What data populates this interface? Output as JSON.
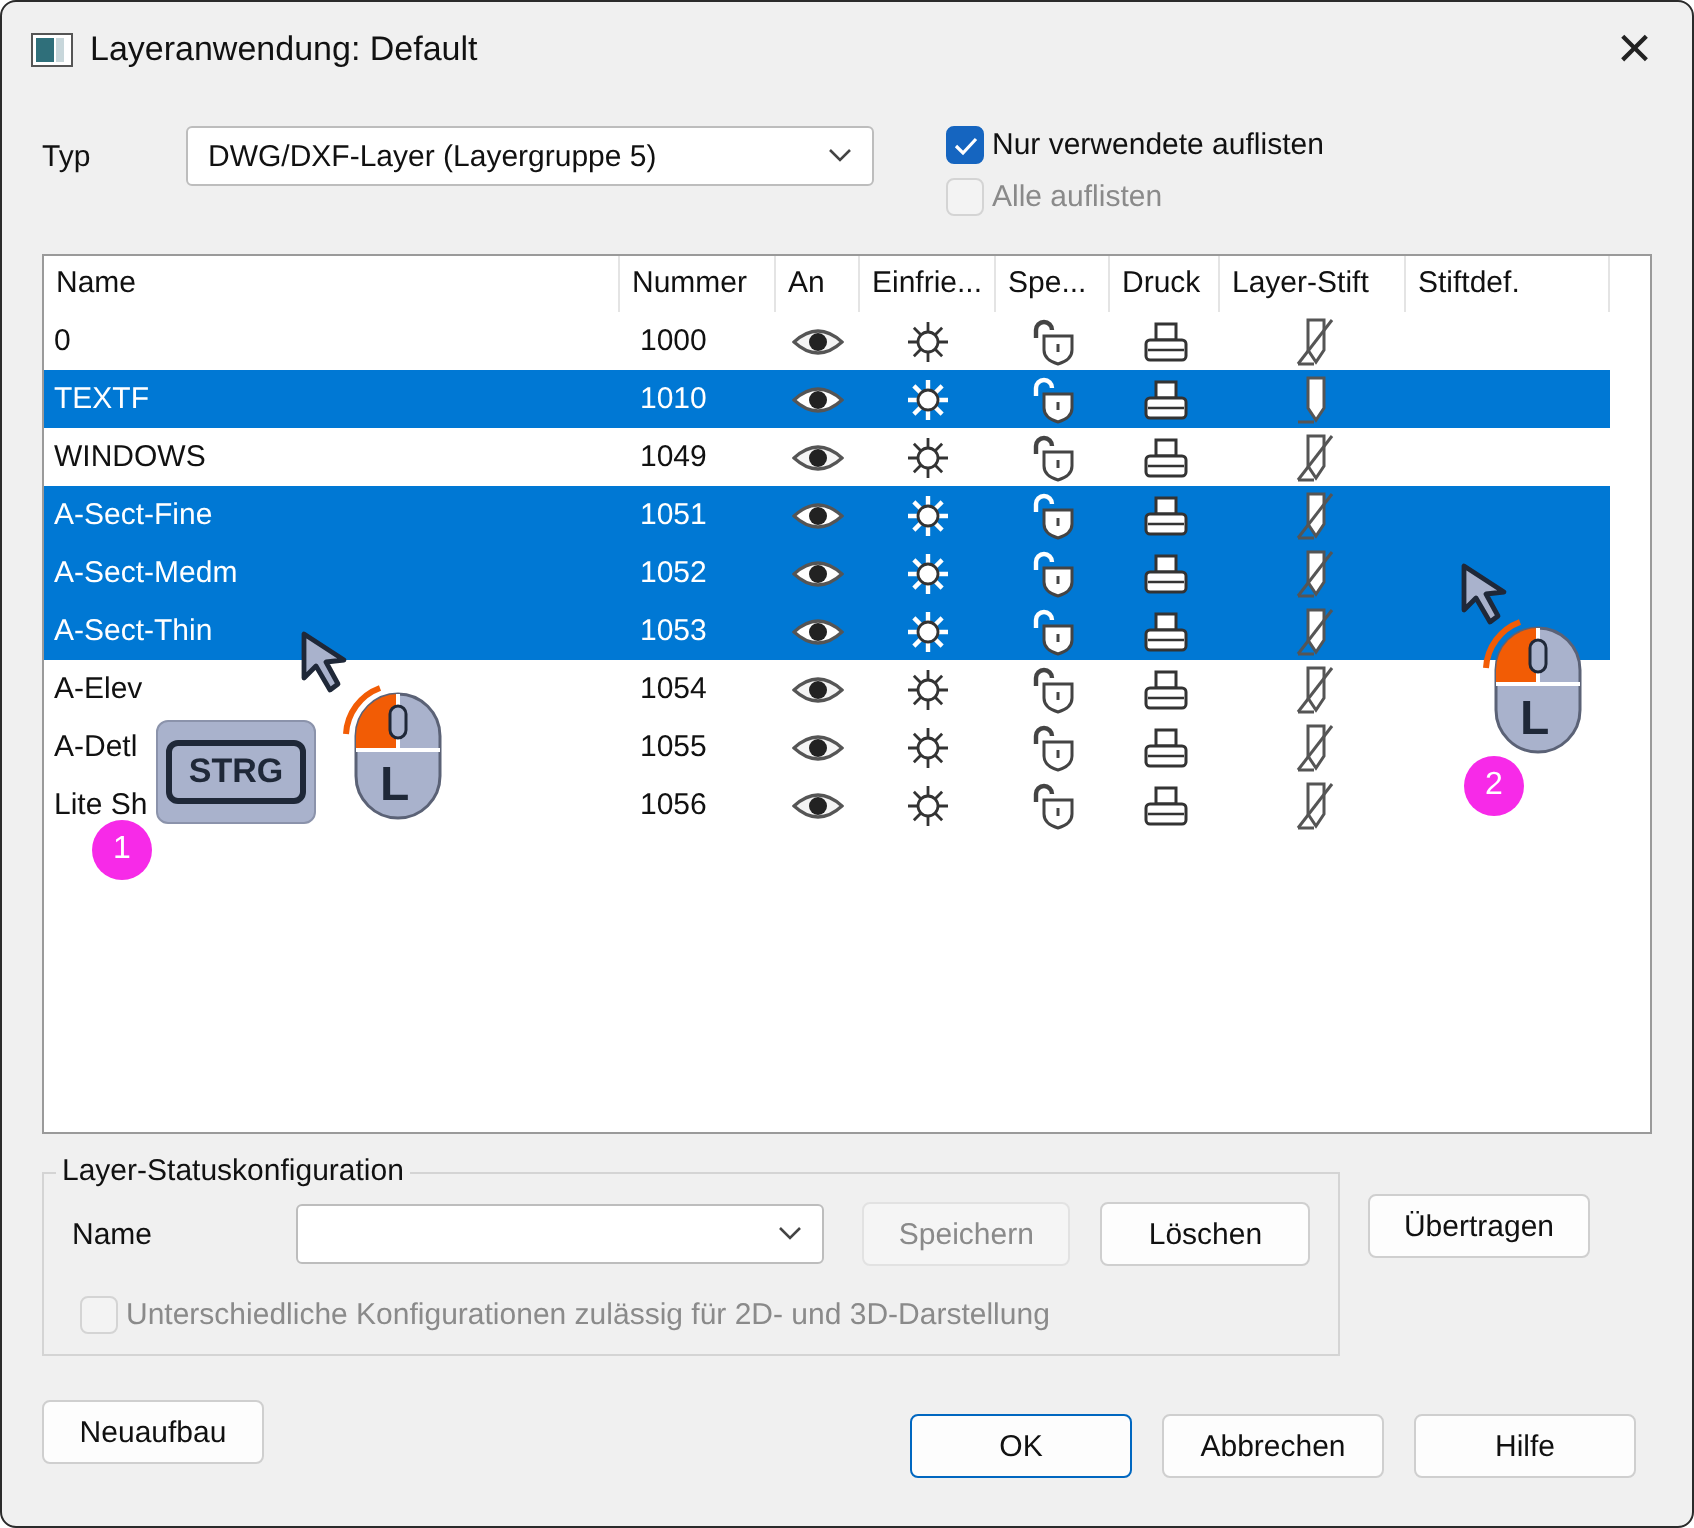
{
  "window": {
    "title": "Layeranwendung: Default",
    "close": "×"
  },
  "type_field": {
    "label": "Typ",
    "value": "DWG/DXF-Layer (Layergruppe 5)"
  },
  "options": [
    {
      "label": "Nur verwendete auflisten",
      "checked": true,
      "disabled": false
    },
    {
      "label": "Alle auflisten",
      "checked": false,
      "disabled": true
    }
  ],
  "table": {
    "columns": [
      "Name",
      "Nummer",
      "An",
      "Einfrie...",
      "Spe...",
      "Druck",
      "Layer-Stift",
      "Stiftdef."
    ],
    "rows": [
      {
        "name": "0",
        "number": "1000",
        "selected": false,
        "pen_crossed": true
      },
      {
        "name": "TEXTF",
        "number": "1010",
        "selected": true,
        "pen_crossed": false
      },
      {
        "name": "WINDOWS",
        "number": "1049",
        "selected": false,
        "pen_crossed": true
      },
      {
        "name": "A-Sect-Fine",
        "number": "1051",
        "selected": true,
        "pen_crossed": true
      },
      {
        "name": "A-Sect-Medm",
        "number": "1052",
        "selected": true,
        "pen_crossed": true
      },
      {
        "name": "A-Sect-Thin",
        "number": "1053",
        "selected": true,
        "pen_crossed": true
      },
      {
        "name": "A-Elev",
        "number": "1054",
        "selected": false,
        "pen_crossed": true
      },
      {
        "name": "A-Detl",
        "number": "1055",
        "selected": false,
        "pen_crossed": true
      },
      {
        "name": "Lite Sh",
        "number": "1056",
        "selected": false,
        "pen_crossed": true
      }
    ]
  },
  "status_config": {
    "title": "Layer-Statuskonfiguration",
    "name_label": "Name",
    "buttons": [
      {
        "label": "Speichern",
        "disabled": true
      },
      {
        "label": "Löschen",
        "disabled": false
      }
    ],
    "option": {
      "label": "Unterschiedliche Konfigurationen zulässig für 2D- und 3D-Darstellung",
      "checked": false,
      "disabled": true
    }
  },
  "side_button": "Übertragen",
  "footer": {
    "left_button": "Neuaufbau",
    "buttons": [
      {
        "label": "OK",
        "default": true
      },
      {
        "label": "Abbrechen",
        "default": false
      },
      {
        "label": "Hilfe",
        "default": false
      }
    ]
  },
  "annotations": {
    "key": "STRG",
    "mouse_labels": [
      "L",
      "L"
    ],
    "badges": [
      "1",
      "2"
    ]
  }
}
